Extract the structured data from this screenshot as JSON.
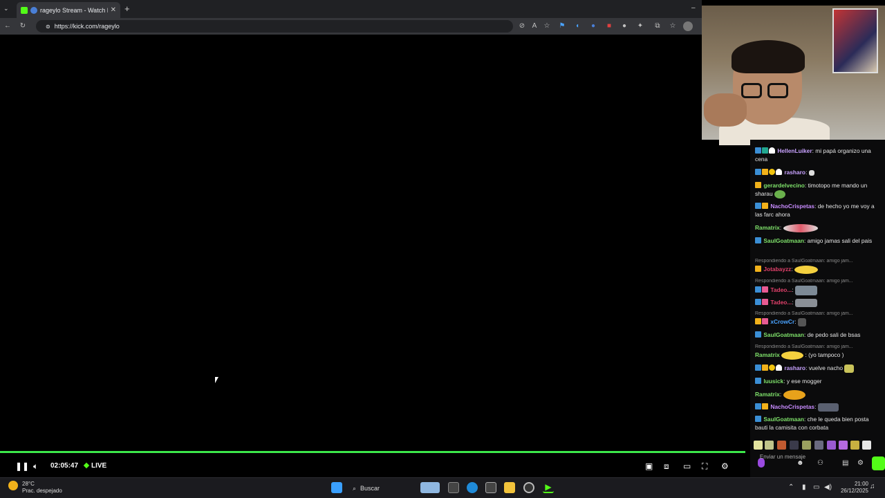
{
  "browser": {
    "tab_title": "rageylo Stream - Watch Live o",
    "url": "https://kick.com/rageylo"
  },
  "player": {
    "elapsed": "02:05:47",
    "live_label": "LIVE",
    "accent": "#53fc18"
  },
  "chat": {
    "messages": [
      {
        "user": "HellenLuiker",
        "color": "#c8a2ff",
        "text": ": mi papá organizo una cena"
      },
      {
        "user": "rasharo",
        "color": "#c8a2ff",
        "text": ":"
      },
      {
        "user": "gerardelvecino",
        "color": "#7ee06a",
        "text": ": timotopo me mando un sharau"
      },
      {
        "user": "NachoCrispetas",
        "color": "#c88cff",
        "text": ": de hecho yo me voy a las farc ahora"
      },
      {
        "user": "Ramatrix",
        "color": "#7ee06a",
        "text": ":"
      },
      {
        "user": "SaulGoatmaan",
        "color": "#7ee06a",
        "text": ": amigo jamas sali del pais"
      },
      {
        "reply": "Respondiendo a SaulGoatmaan: amigo jam..."
      },
      {
        "user": "Jotabayzz",
        "color": "#e0406a",
        "text": ":"
      },
      {
        "reply": "Respondiendo a SaulGoatmaan: amigo jam..."
      },
      {
        "user": "Tadeo...",
        "color": "#e0406a",
        "text": ":"
      },
      {
        "user": "Tadeo...",
        "color": "#e0406a",
        "text": ":"
      },
      {
        "reply": "Respondiendo a SaulGoatmaan: amigo jam..."
      },
      {
        "user": "xCrowCr",
        "color": "#4aa3ff",
        "text": ":"
      },
      {
        "user": "SaulGoatmaan",
        "color": "#7ee06a",
        "text": ": de pedo sali de bsas"
      },
      {
        "reply": "Respondiendo a SaulGoatmaan: amigo jam..."
      },
      {
        "user": "Ramatrix",
        "color": "#7ee06a",
        "text": ": (yo tampoco )"
      },
      {
        "user": "rasharo",
        "color": "#c8a2ff",
        "text": ": vuelve nacho"
      },
      {
        "user": "luusick",
        "color": "#7ee06a",
        "text": ": y ese mogger"
      },
      {
        "user": "Ramatrix",
        "color": "#7ee06a",
        "text": ":"
      },
      {
        "user": "NachoCrispetas",
        "color": "#c88cff",
        "text": ":"
      },
      {
        "user": "SaulGoatmaan",
        "color": "#7ee06a",
        "text": ": che le queda bien posta bauti la camisita con corbata"
      }
    ],
    "input_placeholder": "Enviar un mensaje"
  },
  "taskbar": {
    "temperature": "28°C",
    "weather": "Prac. despejado",
    "search_label": "Buscar",
    "time": "21:00",
    "date": "26/12/2025"
  }
}
